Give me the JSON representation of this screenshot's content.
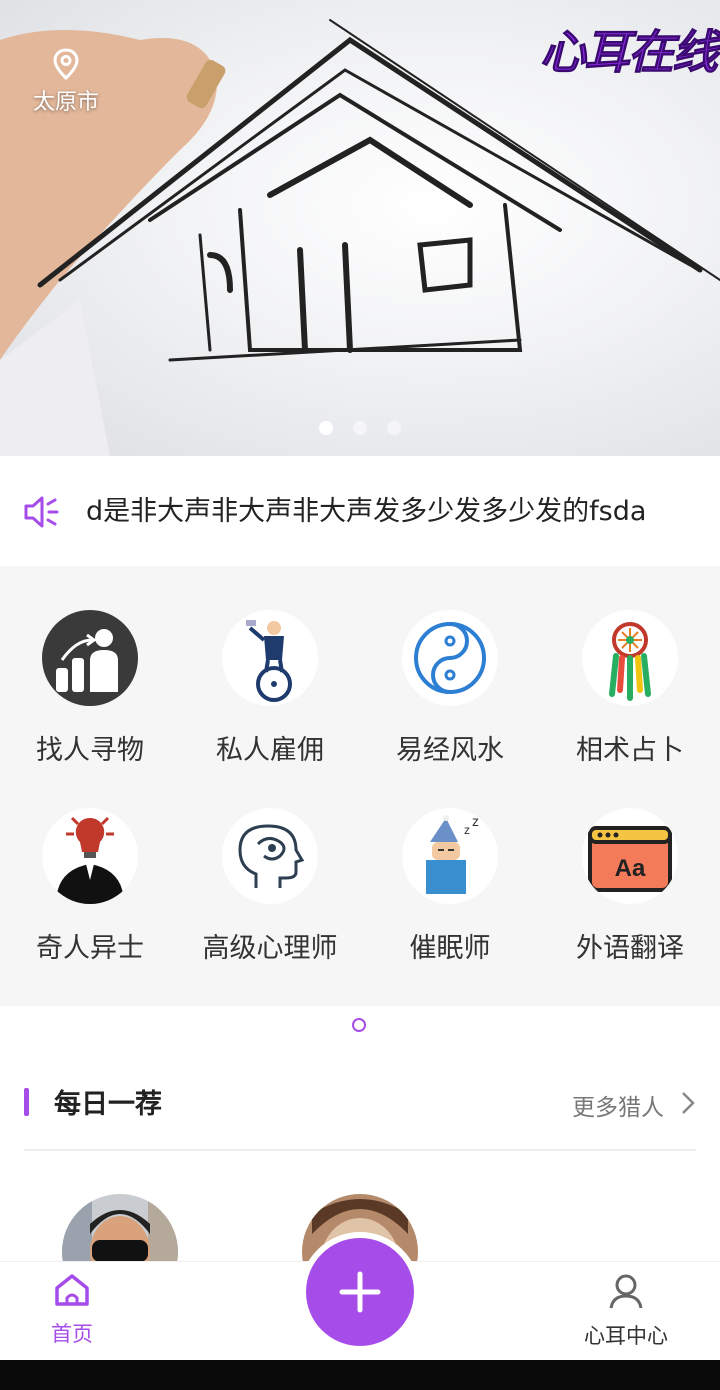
{
  "banner": {
    "location": "太原市",
    "brand": "心耳在线",
    "slide_count": 3,
    "active_slide": 1
  },
  "notice": {
    "text": "d是非大声非大声非大声发多少发多少发的fsda",
    "icon": "speaker-icon"
  },
  "categories": [
    {
      "label": "找人寻物",
      "icon": "people-growth-icon"
    },
    {
      "label": "私人雇佣",
      "icon": "unicycle-businessman-icon"
    },
    {
      "label": "易经风水",
      "icon": "yin-yang-icon"
    },
    {
      "label": "相术占卜",
      "icon": "dreamcatcher-icon"
    },
    {
      "label": "奇人异士",
      "icon": "lightbulb-head-icon"
    },
    {
      "label": "高级心理师",
      "icon": "brain-head-icon"
    },
    {
      "label": "催眠师",
      "icon": "sleeping-person-icon"
    },
    {
      "label": "外语翻译",
      "icon": "aa-window-icon"
    }
  ],
  "daily": {
    "title": "每日一荐",
    "more": "更多猎人"
  },
  "tabbar": {
    "home": "首页",
    "center": "心耳中心",
    "fab_icon": "plus-icon"
  },
  "colors": {
    "accent": "#a64ce8",
    "brand": "#8a2be2"
  }
}
